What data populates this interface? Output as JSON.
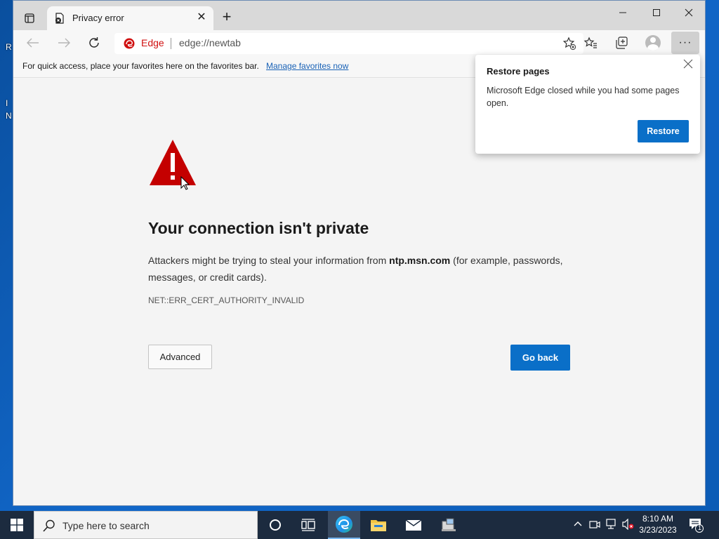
{
  "window": {
    "tab_title": "Privacy error",
    "new_tab_label": "+"
  },
  "toolbar": {
    "edge_label": "Edge",
    "url": "edge://newtab",
    "more_label": "···"
  },
  "favorites_bar": {
    "message": "For quick access, place your favorites here on the favorites bar.",
    "link": "Manage favorites now"
  },
  "error_page": {
    "title": "Your connection isn't private",
    "body_prefix": "Attackers might be trying to steal your information from ",
    "host": "ntp.msn.com",
    "body_suffix": " (for example, passwords, messages, or credit cards).",
    "code": "NET::ERR_CERT_AUTHORITY_INVALID",
    "advanced_label": "Advanced",
    "go_back_label": "Go back"
  },
  "restore_popup": {
    "title": "Restore pages",
    "text": "Microsoft Edge closed while you had some pages open.",
    "button_label": "Restore"
  },
  "taskbar": {
    "search_placeholder": "Type here to search",
    "time": "8:10 AM",
    "date": "3/23/2023",
    "notification_count": "1"
  },
  "desktop": {
    "fragments": [
      "R",
      "I",
      "N"
    ]
  },
  "colors": {
    "accent": "#0a6fc8",
    "warning_red": "#d01010",
    "taskbar": "#1c2b3f"
  }
}
